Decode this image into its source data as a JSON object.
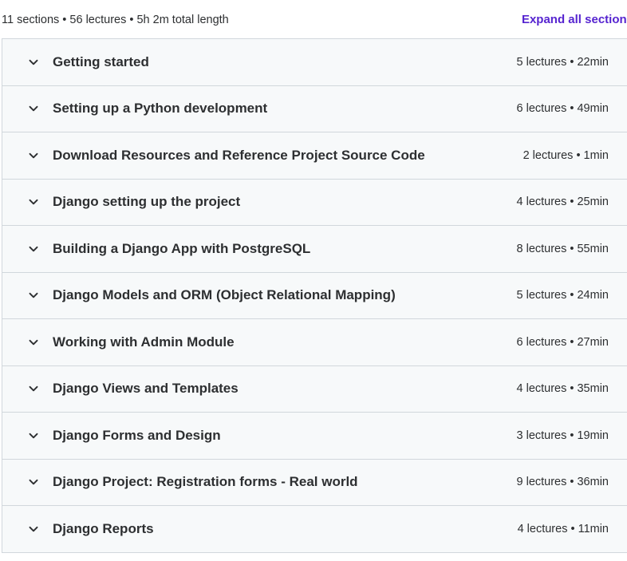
{
  "summary": {
    "text": "11 sections • 56 lectures • 5h 2m total length",
    "expand_label": "Expand all sections"
  },
  "sections": [
    {
      "title": "Getting started",
      "meta": "5 lectures • 22min"
    },
    {
      "title": "Setting up a Python development",
      "meta": "6 lectures • 49min"
    },
    {
      "title": "Download Resources and Reference Project Source Code",
      "meta": "2 lectures • 1min"
    },
    {
      "title": "Django setting up the project",
      "meta": "4 lectures • 25min"
    },
    {
      "title": "Building a Django App with PostgreSQL",
      "meta": "8 lectures • 55min"
    },
    {
      "title": "Django Models and ORM (Object Relational Mapping)",
      "meta": "5 lectures • 24min"
    },
    {
      "title": "Working with Admin Module",
      "meta": "6 lectures • 27min"
    },
    {
      "title": "Django Views and Templates",
      "meta": "4 lectures • 35min"
    },
    {
      "title": "Django Forms and Design",
      "meta": "3 lectures • 19min"
    },
    {
      "title": "Django Project: Registration forms - Real world",
      "meta": "9 lectures • 36min"
    },
    {
      "title": "Django Reports",
      "meta": "4 lectures • 11min"
    }
  ],
  "icons": {
    "section_toggle": "chevron-down-icon"
  },
  "colors": {
    "accent": "#5624d0",
    "section_bg": "#f7f9fa",
    "border": "#d1d7dc",
    "text": "#2d2f31"
  }
}
